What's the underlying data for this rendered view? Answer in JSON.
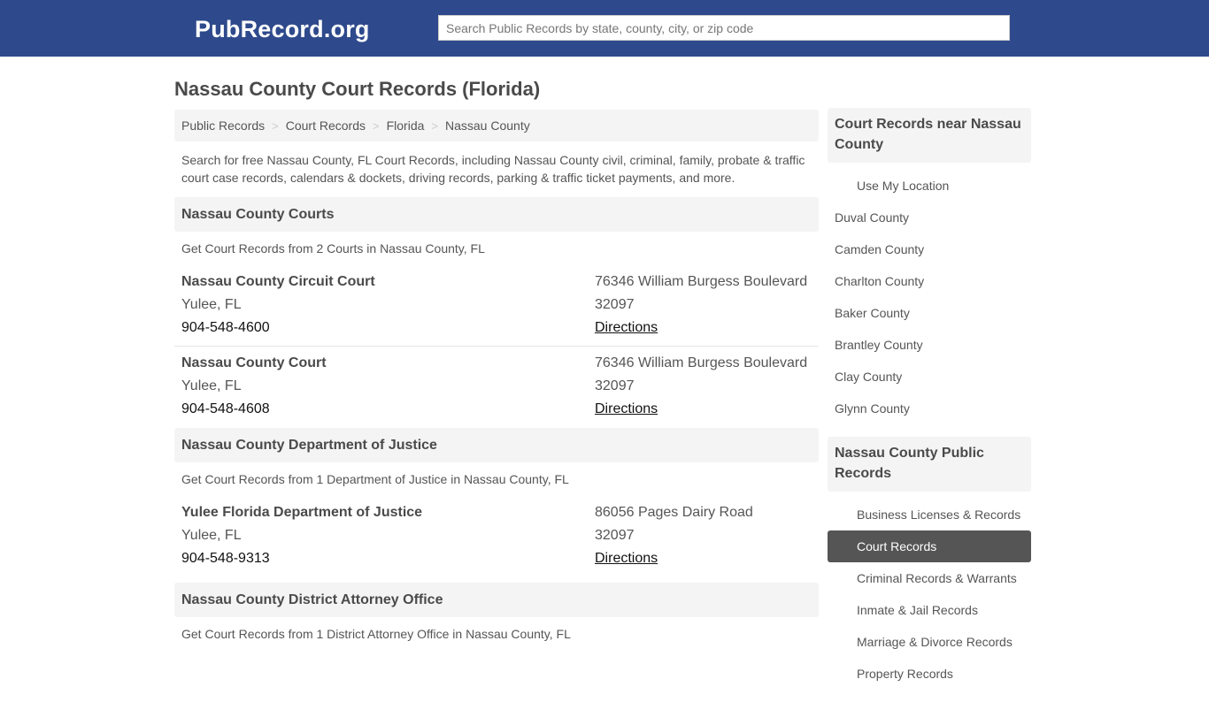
{
  "header": {
    "logo": "PubRecord.org",
    "search_placeholder": "Search Public Records by state, county, city, or zip code"
  },
  "page_title": "Nassau County Court Records (Florida)",
  "breadcrumb": [
    "Public Records",
    "Court Records",
    "Florida",
    "Nassau County"
  ],
  "breadcrumb_separator": ">",
  "intro": "Search for free Nassau County, FL Court Records, including Nassau County civil, criminal, family, probate & traffic court case records, calendars & dockets, driving records, parking & traffic ticket payments, and more.",
  "sections": [
    {
      "title": "Nassau County Courts",
      "subtitle": "Get Court Records from 2 Courts in Nassau County, FL",
      "entries": [
        {
          "name": "Nassau County Circuit Court",
          "city": "Yulee, FL",
          "phone": "904-548-4600",
          "address": "76346 William Burgess Boulevard",
          "zip": "32097",
          "directions": "Directions"
        },
        {
          "name": "Nassau County Court",
          "city": "Yulee, FL",
          "phone": "904-548-4608",
          "address": "76346 William Burgess Boulevard",
          "zip": "32097",
          "directions": "Directions"
        }
      ]
    },
    {
      "title": "Nassau County Department of Justice",
      "subtitle": "Get Court Records from 1 Department of Justice in Nassau County, FL",
      "entries": [
        {
          "name": "Yulee Florida Department of Justice",
          "city": "Yulee, FL",
          "phone": "904-548-9313",
          "address": "86056 Pages Dairy Road",
          "zip": "32097",
          "directions": "Directions"
        }
      ]
    },
    {
      "title": "Nassau County District Attorney Office",
      "subtitle": "Get Court Records from 1 District Attorney Office in Nassau County, FL",
      "entries": []
    }
  ],
  "sidebar": {
    "nearby": {
      "title": "Court Records near Nassau County",
      "use_location": "Use My Location",
      "counties": [
        "Duval County",
        "Camden County",
        "Charlton County",
        "Baker County",
        "Brantley County",
        "Clay County",
        "Glynn County"
      ]
    },
    "public_records": {
      "title": "Nassau County Public Records",
      "items": [
        "Business Licenses & Records",
        "Court Records",
        "Criminal Records & Warrants",
        "Inmate & Jail Records",
        "Marriage & Divorce Records",
        "Property Records"
      ],
      "active": "Court Records"
    }
  }
}
